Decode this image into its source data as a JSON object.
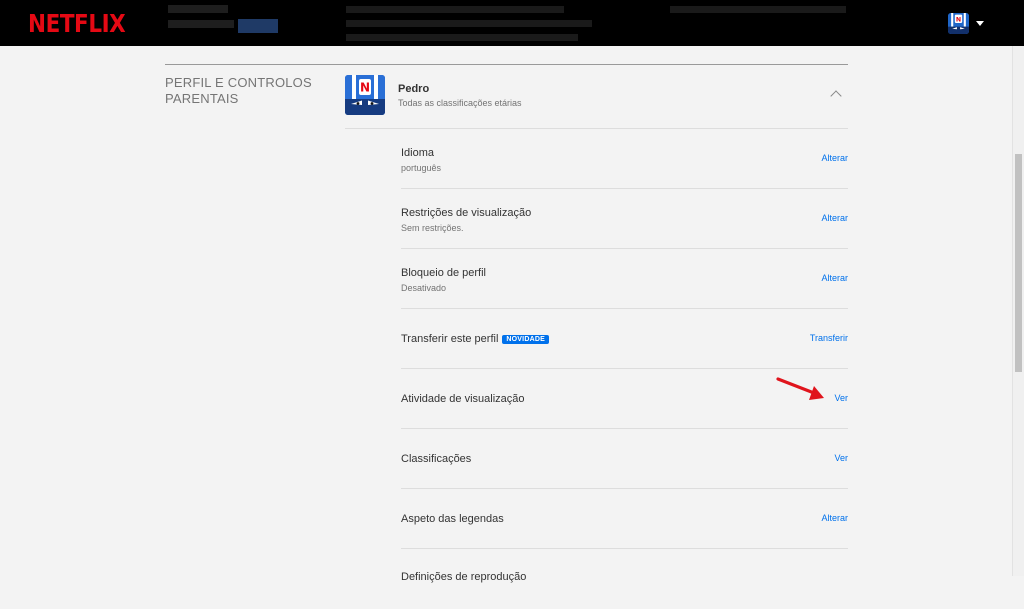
{
  "header": {
    "logo": "NETFLIX",
    "avatar_icon": "netflix-kids-avatar"
  },
  "section": {
    "title": "PERFIL E CONTROLOS PARENTAIS"
  },
  "profile": {
    "name": "Pedro",
    "rating": "Todas as classificações etárias"
  },
  "settings": [
    {
      "label": "Idioma",
      "value": "português",
      "link": "Alterar"
    },
    {
      "label": "Restrições de visualização",
      "value": "Sem restrições.",
      "link": "Alterar"
    },
    {
      "label": "Bloqueio de perfil",
      "value": "Desativado",
      "link": "Alterar"
    },
    {
      "label": "Transferir este perfil",
      "badge": "NOVIDADE",
      "link": "Transferir"
    },
    {
      "label": "Atividade de visualização",
      "link": "Ver"
    },
    {
      "label": "Classificações",
      "link": "Ver"
    },
    {
      "label": "Aspeto das legendas",
      "link": "Alterar"
    },
    {
      "label": "Definições de reprodução"
    }
  ],
  "colors": {
    "brand_red": "#e50914",
    "link_blue": "#0071eb",
    "annotation_arrow": "#e0141c"
  }
}
